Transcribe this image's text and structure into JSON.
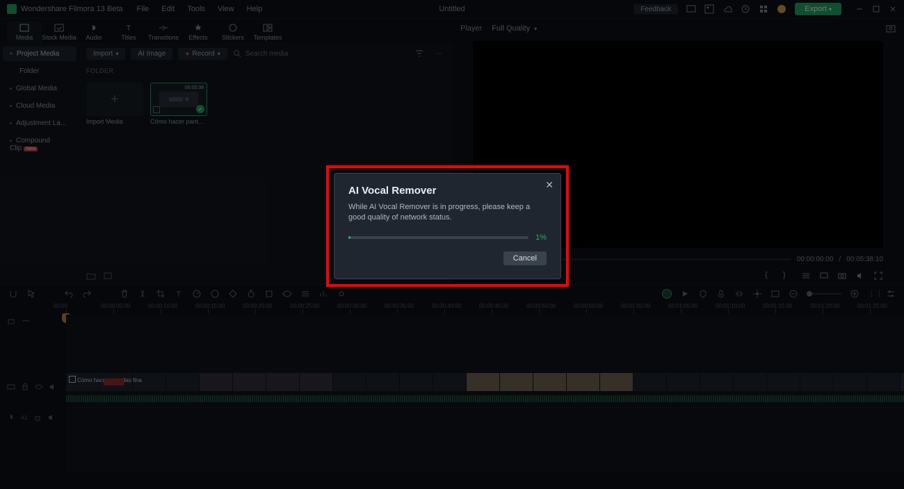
{
  "app": {
    "name": "Wondershare Filmora 13 Beta",
    "doc_title": "Untitled"
  },
  "menus": [
    "File",
    "Edit",
    "Tools",
    "View",
    "Help"
  ],
  "titlebar": {
    "feedback": "Feedback",
    "export": "Export"
  },
  "tool_tabs": [
    {
      "label": "Media",
      "icon": "media"
    },
    {
      "label": "Stock Media",
      "icon": "stock"
    },
    {
      "label": "Audio",
      "icon": "audio"
    },
    {
      "label": "Titles",
      "icon": "titles"
    },
    {
      "label": "Transitions",
      "icon": "transitions"
    },
    {
      "label": "Effects",
      "icon": "effects"
    },
    {
      "label": "Stickers",
      "icon": "stickers"
    },
    {
      "label": "Templates",
      "icon": "templates"
    }
  ],
  "sidebar": {
    "items": [
      {
        "label": "Project Media",
        "active": true
      },
      {
        "label": "Folder",
        "sub": true
      },
      {
        "label": "Global Media"
      },
      {
        "label": "Cloud Media"
      },
      {
        "label": "Adjustment La..."
      },
      {
        "label": "Compound Clip",
        "new": true
      }
    ]
  },
  "media_toolbar": {
    "import": "Import",
    "ai_image": "AI Image",
    "record": "Record",
    "search_ph": "Search media"
  },
  "folder_label": "FOLDER",
  "thumbs": {
    "import_label": "Import Media",
    "clip_duration": "00:05:38",
    "clip_label": "Cómo hacer pantallas ..."
  },
  "player": {
    "tab": "Player",
    "quality": "Full Quality",
    "tc_current": "00:00:00:00",
    "tc_sep": "/",
    "tc_total": "00:05:38:10"
  },
  "ruler_marks": [
    "00:00",
    "00:00:05:00",
    "00:00:10:00",
    "00:00:15:00",
    "00:00:20:00",
    "00:00:25:00",
    "00:00:30:00",
    "00:00:35:00",
    "00:00:40:00",
    "00:00:45:00",
    "00:00:50:00",
    "00:00:55:00",
    "00:01:00:00",
    "00:01:05:00",
    "00:01:10:00",
    "00:01:15:00",
    "00:01:20:00",
    "00:01:25:00"
  ],
  "clip": {
    "label": "Cómo hacer pantallas fina"
  },
  "track_heads": {
    "video": "",
    "audio": "A1"
  },
  "modal": {
    "title": "AI Vocal Remover",
    "body": "While AI Vocal Remover is in progress, please keep a good quality of network status.",
    "pct": "1%",
    "cancel": "Cancel"
  }
}
